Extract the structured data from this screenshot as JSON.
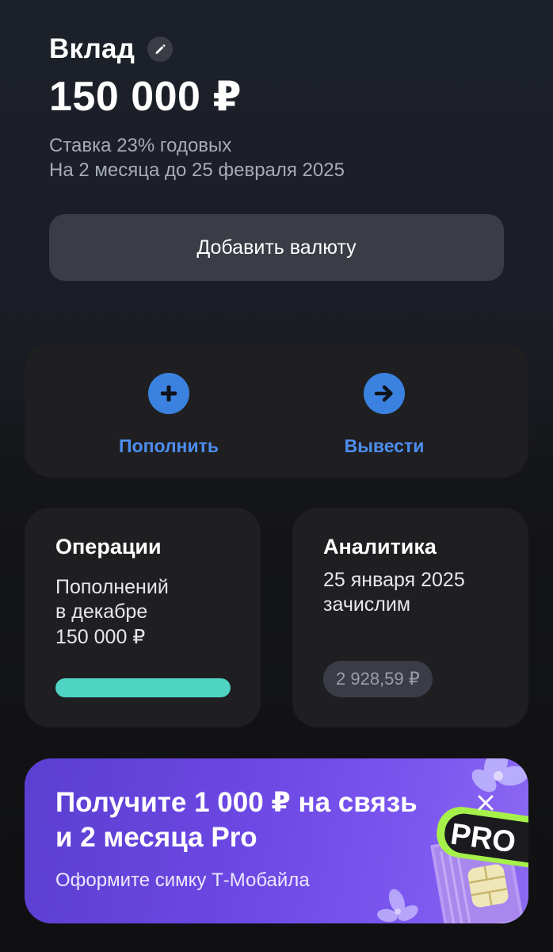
{
  "header": {
    "title": "Вклад",
    "edit_icon": "pencil-icon",
    "amount": "150 000 ₽",
    "rate": "Ставка 23% годовых",
    "term": "На 2 месяца до 25 февраля 2025"
  },
  "add_currency": {
    "label": "Добавить валюту"
  },
  "actions": {
    "topup": {
      "label": "Пополнить",
      "icon": "plus-icon"
    },
    "withdraw": {
      "label": "Вывести",
      "icon": "arrow-right-icon"
    }
  },
  "operations": {
    "title": "Операции",
    "line1": "Пополнений",
    "line2": "в декабре",
    "line3": "150 000 ₽",
    "progress_fraction": 1.0
  },
  "analytics": {
    "title": "Аналитика",
    "line1": "25 января 2025",
    "line2": "зачислим",
    "badge": "2 928,59 ₽"
  },
  "promo": {
    "title_line1": "Получите 1 000 ₽ на связь",
    "title_line2": "и 2 месяца Pro",
    "subtitle": "Оформите симку Т-Мобайла",
    "badge_text": "PRO",
    "close_icon": "close-icon"
  },
  "colors": {
    "accent_blue": "#3b82e0",
    "link_blue": "#4d8ef0",
    "progress_teal": "#4fd4c3",
    "promo_purple": "#6d48e4"
  }
}
